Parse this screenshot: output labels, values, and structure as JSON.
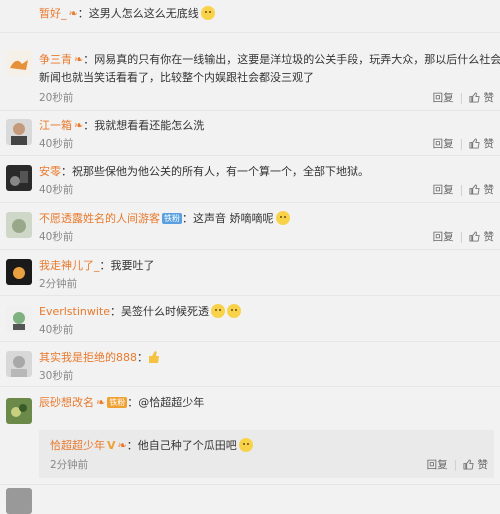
{
  "comments": [
    {
      "name": "暂好_",
      "text": "：这男人怎么这么无底线",
      "meta": "",
      "emoji": true
    },
    {
      "name": "争三青",
      "text": "：网易真的只有你在一线输出，这要是洋垃圾的公关手段，玩弄大众，那以后什么社会",
      "text2": "新闻也就当笑话看看了，比较整个内娱跟社会都没三观了",
      "meta": "20秒前"
    },
    {
      "name": "江一箱",
      "text": "：我就想看看还能怎么洗",
      "meta": "40秒前"
    },
    {
      "name": "安零",
      "text": "：祝那些保他为他公关的所有人，有一个算一个，全部下地狱。",
      "meta": "40秒前"
    },
    {
      "name": "不愿透露姓名的人间游客",
      "badge": "铁粉",
      "text": "：这声音 娇嘀嘀呢",
      "meta": "40秒前",
      "emoji": true
    },
    {
      "name": "我走神儿了_",
      "text": "：我要吐了",
      "meta": "2分钟前"
    },
    {
      "name": "Everlstinwite",
      "text": "：吴签什么时候死透",
      "meta": "40秒前",
      "emoji": true
    },
    {
      "name": "其实我是拒绝的888",
      "text": "：",
      "meta": "30秒前",
      "thumb": true
    },
    {
      "name": "辰砂想改名",
      "badge": "铁粉",
      "text": "：@恰超超少年",
      "meta": "2分钟前"
    }
  ],
  "reply": {
    "name": "恰超超少年",
    "v": "V",
    "text": "：他自己种了个瓜田吧",
    "meta": "2分钟前",
    "emoji": true
  },
  "actions": {
    "reply": "回复",
    "sep": "|",
    "like": "赞"
  },
  "colors": {
    "name": "#e8792c",
    "badge": "#f0a030",
    "badge2": "#5aa0e0"
  }
}
